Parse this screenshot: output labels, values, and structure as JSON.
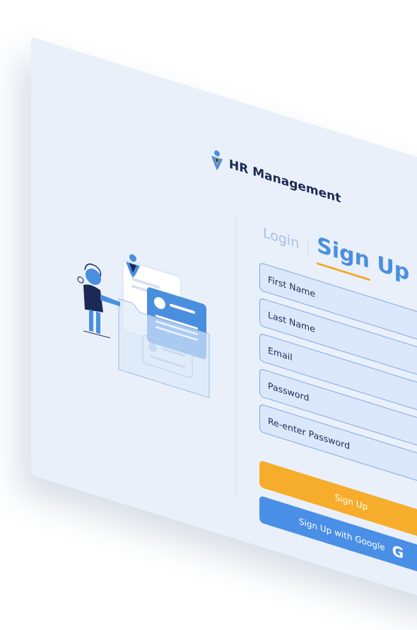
{
  "brand": {
    "name": "HR Management"
  },
  "tabs": {
    "login": "Login",
    "signup": "Sign Up"
  },
  "form": {
    "fields": [
      {
        "label": "First Name"
      },
      {
        "label": "Last Name"
      },
      {
        "label": "Email"
      },
      {
        "label": "Password"
      },
      {
        "label": "Re-enter Password"
      }
    ],
    "signup_button": "Sign Up",
    "google_button": "Sign Up with Google",
    "google_icon": "G"
  },
  "colors": {
    "card_bg": "#e9f0fa",
    "primary_blue": "#4a8fdf",
    "accent_orange": "#f6ad2b",
    "navy": "#1b2a55",
    "field_bg": "#dbe8fb"
  }
}
